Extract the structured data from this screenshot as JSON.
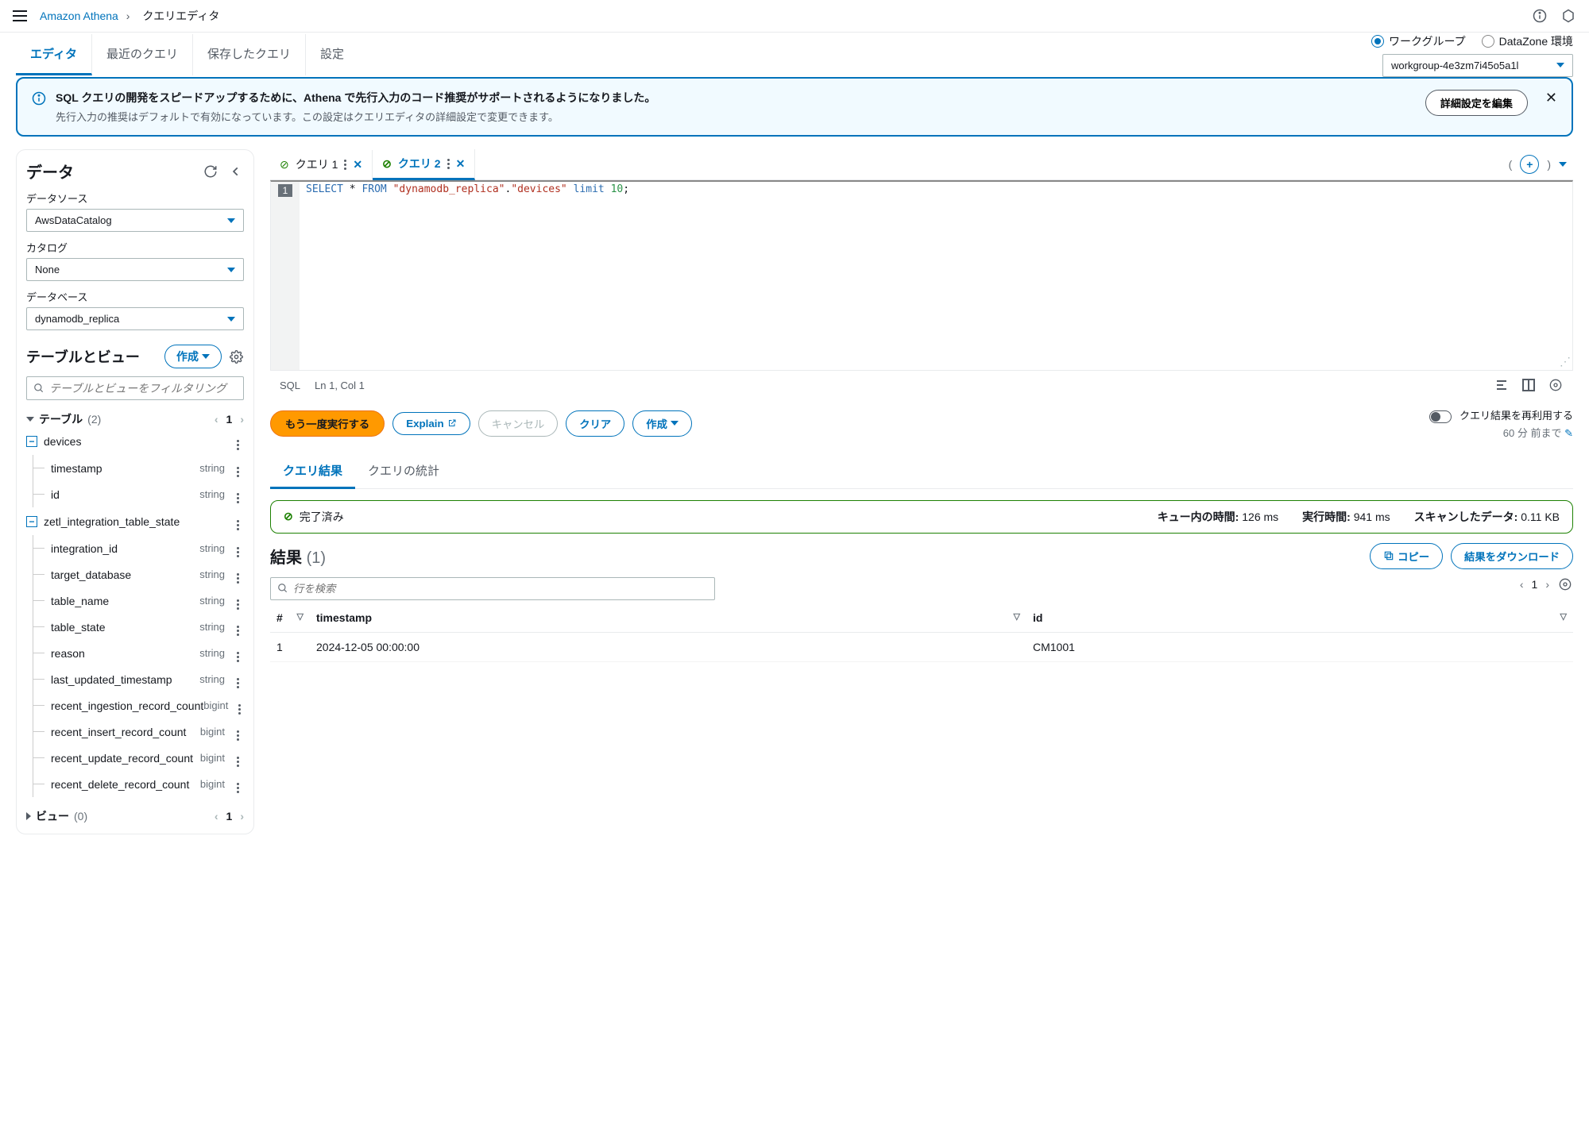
{
  "breadcrumb": {
    "service": "Amazon Athena",
    "page": "クエリエディタ"
  },
  "tabs": {
    "editor": "エディタ",
    "recent": "最近のクエリ",
    "saved": "保存したクエリ",
    "settings": "設定"
  },
  "workgroup": {
    "radio1": "ワークグループ",
    "radio2": "DataZone 環境",
    "value": "workgroup-4e3zm7i45o5a1l"
  },
  "banner": {
    "title": "SQL クエリの開発をスピードアップするために、Athena で先行入力のコード推奨がサポートされるようになりました。",
    "sub": "先行入力の推奨はデフォルトで有効になっています。この設定はクエリエディタの詳細設定で変更できます。",
    "btn": "詳細設定を編集"
  },
  "sidebar": {
    "heading": "データ",
    "datasource_label": "データソース",
    "datasource_value": "AwsDataCatalog",
    "catalog_label": "カタログ",
    "catalog_value": "None",
    "database_label": "データベース",
    "database_value": "dynamodb_replica",
    "tv_heading": "テーブルとビュー",
    "create_btn": "作成",
    "filter_ph": "テーブルとビューをフィルタリング",
    "tables_label": "テーブル",
    "tables_count": "(2)",
    "tables_page": "1",
    "views_label": "ビュー",
    "views_count": "(0)",
    "views_page": "1",
    "tables": [
      {
        "name": "devices",
        "columns": [
          {
            "name": "timestamp",
            "type": "string"
          },
          {
            "name": "id",
            "type": "string"
          }
        ]
      },
      {
        "name": "zetl_integration_table_state",
        "columns": [
          {
            "name": "integration_id",
            "type": "string"
          },
          {
            "name": "target_database",
            "type": "string"
          },
          {
            "name": "table_name",
            "type": "string"
          },
          {
            "name": "table_state",
            "type": "string"
          },
          {
            "name": "reason",
            "type": "string"
          },
          {
            "name": "last_updated_timestamp",
            "type": "string"
          },
          {
            "name": "recent_ingestion_record_count",
            "type": "bigint"
          },
          {
            "name": "recent_insert_record_count",
            "type": "bigint"
          },
          {
            "name": "recent_update_record_count",
            "type": "bigint"
          },
          {
            "name": "recent_delete_record_count",
            "type": "bigint"
          }
        ]
      }
    ]
  },
  "editor": {
    "tab1": "クエリ 1",
    "tab2": "クエリ 2",
    "sql_kw1": "SELECT",
    "sql_star": " * ",
    "sql_kw2": "FROM",
    "sql_str1": "\"dynamodb_replica\"",
    "sql_dot": ".",
    "sql_str2": "\"devices\"",
    "sql_kw3": " limit ",
    "sql_num": "10",
    "sql_end": ";",
    "line1": "1",
    "lang": "SQL",
    "pos": "Ln 1, Col 1"
  },
  "actions": {
    "run": "もう一度実行する",
    "explain": "Explain",
    "cancel": "キャンセル",
    "clear": "クリア",
    "create": "作成",
    "reuse": "クエリ結果を再利用する",
    "reuse_sub": "60 分 前まで"
  },
  "results": {
    "tab1": "クエリ結果",
    "tab2": "クエリの統計",
    "status": "完了済み",
    "m1_label": "キュー内の時間:",
    "m1_val": "126 ms",
    "m2_label": "実行時間:",
    "m2_val": "941 ms",
    "m3_label": "スキャンしたデータ:",
    "m3_val": "0.11 KB",
    "heading": "結果",
    "count": "(1)",
    "copy_btn": "コピー",
    "download_btn": "結果をダウンロード",
    "search_ph": "行を検索",
    "page": "1",
    "cols": {
      "idx": "#",
      "timestamp": "timestamp",
      "id": "id"
    },
    "rows": [
      {
        "idx": "1",
        "timestamp": "2024-12-05 00:00:00",
        "id": "CM1001"
      }
    ]
  }
}
